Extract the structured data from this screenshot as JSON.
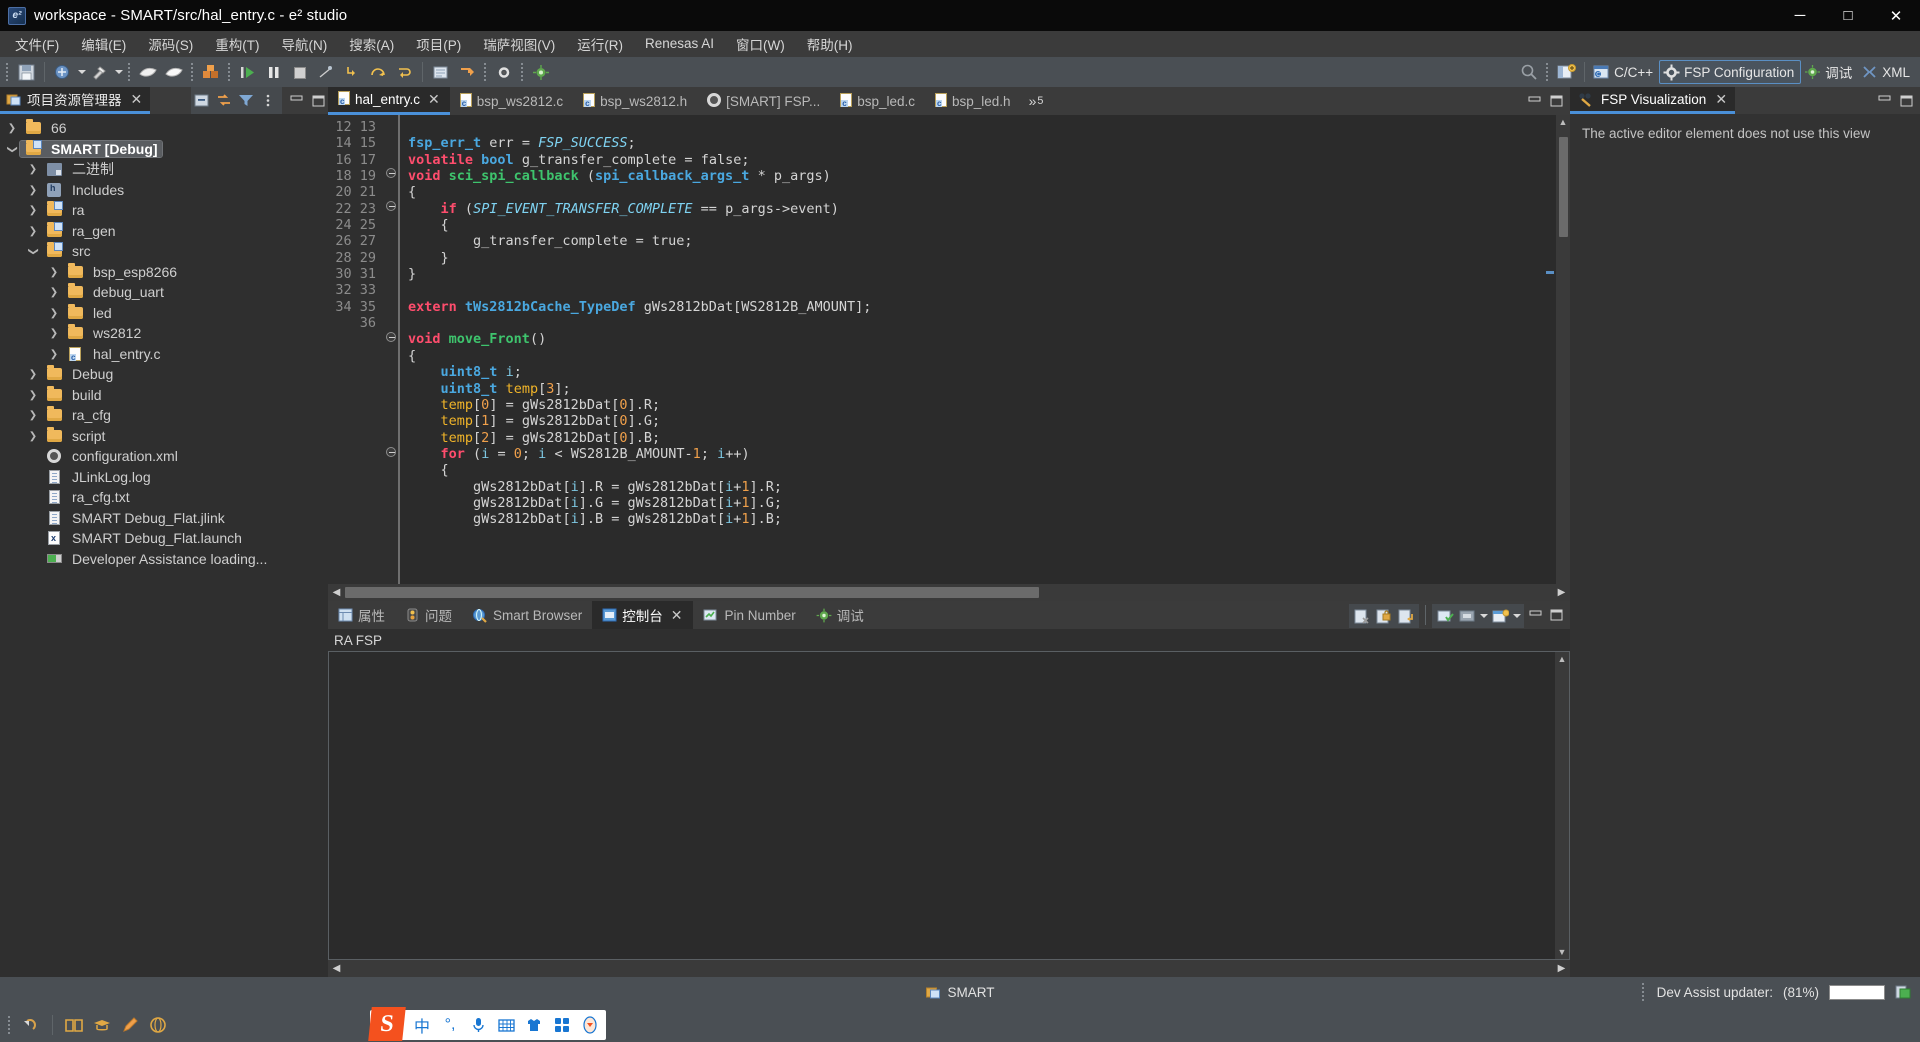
{
  "window": {
    "title": "workspace - SMART/src/hal_entry.c - e² studio",
    "app_icon": "e2studio-icon",
    "minimize": "─",
    "maximize": "□",
    "close": "✕"
  },
  "menubar": {
    "items": [
      {
        "label": "文件(F)",
        "name": "menu-file"
      },
      {
        "label": "编辑(E)",
        "name": "menu-edit"
      },
      {
        "label": "源码(S)",
        "name": "menu-source"
      },
      {
        "label": "重构(T)",
        "name": "menu-refactor"
      },
      {
        "label": "导航(N)",
        "name": "menu-navigate"
      },
      {
        "label": "搜索(A)",
        "name": "menu-search"
      },
      {
        "label": "项目(P)",
        "name": "menu-project"
      },
      {
        "label": "瑞萨视图(V)",
        "name": "menu-renesas-views"
      },
      {
        "label": "运行(R)",
        "name": "menu-run"
      },
      {
        "label": "Renesas AI",
        "name": "menu-renesas-ai"
      },
      {
        "label": "窗口(W)",
        "name": "menu-window"
      },
      {
        "label": "帮助(H)",
        "name": "menu-help"
      }
    ]
  },
  "toolbar": {
    "perspectives": [
      {
        "label": "C/C++",
        "name": "perspective-cpp",
        "active": false
      },
      {
        "label": "FSP Configuration",
        "name": "perspective-fsp-configuration",
        "active": true
      },
      {
        "label": "调试",
        "name": "perspective-debug",
        "active": false
      },
      {
        "label": "XML",
        "name": "perspective-xml",
        "active": false
      }
    ]
  },
  "project_explorer": {
    "tab_label": "项目资源管理器",
    "tab_icon": "project-explorer-icon",
    "close_label": "✕",
    "tree": [
      {
        "label": "66",
        "icon": "folder",
        "depth": 0,
        "twist": "closed",
        "selected": false
      },
      {
        "label": "SMART [Debug]",
        "icon": "project-folder",
        "depth": 0,
        "twist": "open",
        "selected": true
      },
      {
        "label": "二进制",
        "icon": "binary",
        "depth": 1,
        "twist": "closed",
        "selected": false
      },
      {
        "label": "Includes",
        "icon": "includes",
        "depth": 1,
        "twist": "closed",
        "selected": false
      },
      {
        "label": "ra",
        "icon": "project-folder",
        "depth": 1,
        "twist": "closed",
        "selected": false
      },
      {
        "label": "ra_gen",
        "icon": "project-folder",
        "depth": 1,
        "twist": "closed",
        "selected": false
      },
      {
        "label": "src",
        "icon": "project-folder",
        "depth": 1,
        "twist": "open",
        "selected": false
      },
      {
        "label": "bsp_esp8266",
        "icon": "folder",
        "depth": 2,
        "twist": "closed",
        "selected": false
      },
      {
        "label": "debug_uart",
        "icon": "folder",
        "depth": 2,
        "twist": "closed",
        "selected": false
      },
      {
        "label": "led",
        "icon": "folder",
        "depth": 2,
        "twist": "closed",
        "selected": false
      },
      {
        "label": "ws2812",
        "icon": "folder",
        "depth": 2,
        "twist": "closed",
        "selected": false
      },
      {
        "label": "hal_entry.c",
        "icon": "c-file",
        "depth": 2,
        "twist": "closed",
        "selected": false
      },
      {
        "label": "Debug",
        "icon": "folder",
        "depth": 1,
        "twist": "closed",
        "selected": false
      },
      {
        "label": "build",
        "icon": "folder",
        "depth": 1,
        "twist": "closed",
        "selected": false
      },
      {
        "label": "ra_cfg",
        "icon": "folder",
        "depth": 1,
        "twist": "closed",
        "selected": false
      },
      {
        "label": "script",
        "icon": "folder",
        "depth": 1,
        "twist": "closed",
        "selected": false
      },
      {
        "label": "configuration.xml",
        "icon": "gear",
        "depth": 1,
        "twist": "none",
        "selected": false
      },
      {
        "label": "JLinkLog.log",
        "icon": "text-file",
        "depth": 1,
        "twist": "none",
        "selected": false
      },
      {
        "label": "ra_cfg.txt",
        "icon": "text-file",
        "depth": 1,
        "twist": "none",
        "selected": false
      },
      {
        "label": "SMART Debug_Flat.jlink",
        "icon": "text-file",
        "depth": 1,
        "twist": "none",
        "selected": false
      },
      {
        "label": "SMART Debug_Flat.launch",
        "icon": "xml-file",
        "depth": 1,
        "twist": "none",
        "selected": false
      },
      {
        "label": "Developer Assistance loading...",
        "icon": "dev-assist",
        "depth": 1,
        "twist": "none",
        "selected": false
      }
    ]
  },
  "editor": {
    "tabs": [
      {
        "label": "hal_entry.c",
        "icon": "c-file",
        "active": true,
        "closable": true
      },
      {
        "label": "bsp_ws2812.c",
        "icon": "c-file",
        "active": false,
        "closable": false
      },
      {
        "label": "bsp_ws2812.h",
        "icon": "c-file",
        "active": false,
        "closable": false
      },
      {
        "label": "[SMART] FSP...",
        "icon": "gear",
        "active": false,
        "closable": false
      },
      {
        "label": "bsp_led.c",
        "icon": "c-file",
        "active": false,
        "closable": false
      },
      {
        "label": "bsp_led.h",
        "icon": "c-file",
        "active": false,
        "closable": false
      }
    ],
    "more_tabs_symbol": "»",
    "more_tabs_count": "5",
    "first_line_number": 12,
    "line_numbers": [
      12,
      13,
      14,
      15,
      16,
      17,
      18,
      19,
      20,
      21,
      22,
      23,
      24,
      25,
      26,
      27,
      28,
      29,
      30,
      31,
      32,
      33,
      34,
      35,
      36
    ],
    "code_lines": [
      "",
      "fsp_err_t err = FSP_SUCCESS;",
      "volatile bool g_transfer_complete = false;",
      "void sci_spi_callback (spi_callback_args_t * p_args)",
      "{",
      "    if (SPI_EVENT_TRANSFER_COMPLETE == p_args->event)",
      "    {",
      "        g_transfer_complete = true;",
      "    }",
      "}",
      "",
      "extern tWs2812bCache_TypeDef gWs2812bDat[WS2812B_AMOUNT];",
      "",
      "void move_Front()",
      "{",
      "    uint8_t i;",
      "    uint8_t temp[3];",
      "    temp[0] = gWs2812bDat[0].R;",
      "    temp[1] = gWs2812bDat[0].G;",
      "    temp[2] = gWs2812bDat[0].B;",
      "    for (i = 0; i < WS2812B_AMOUNT-1; i++)",
      "    {",
      "        gWs2812bDat[i].R = gWs2812bDat[i+1].R;",
      "        gWs2812bDat[i].G = gWs2812bDat[i+1].G;",
      "        gWs2812bDat[i].B = gWs2812bDat[i+1].B;"
    ],
    "colors": {
      "keyword": "#ff4d6d",
      "type": "#4aa8e0",
      "function": "#3ec46d",
      "macro": "#7fd3f2",
      "number": "#f0a04b",
      "variable": "#f0b429",
      "plain": "#d4d4d4",
      "background": "#2b2b2b",
      "gutter_text": "#8c8c8c"
    }
  },
  "bottom_panel": {
    "tabs": [
      {
        "label": "属性",
        "icon": "properties-icon",
        "active": false,
        "closable": false
      },
      {
        "label": "问题",
        "icon": "problems-icon",
        "active": false,
        "closable": false
      },
      {
        "label": "Smart Browser",
        "icon": "smart-browser-icon",
        "active": false,
        "closable": false
      },
      {
        "label": "控制台",
        "icon": "console-icon",
        "active": true,
        "closable": true
      },
      {
        "label": "Pin Number",
        "icon": "pin-number-icon",
        "active": false,
        "closable": false
      },
      {
        "label": "调试",
        "icon": "debug-icon",
        "active": false,
        "closable": false
      }
    ],
    "console_title": "RA FSP",
    "console_output": ""
  },
  "fsp_visualization": {
    "tab_label": "FSP Visualization",
    "tab_icon": "fsp-visualization-icon",
    "close_label": "✕",
    "message": "The active editor element does not use this view"
  },
  "statusbar": {
    "project_label": "SMART",
    "project_icon": "project-folder-icon",
    "updater_label": "Dev Assist updater:",
    "updater_progress": "(81%)"
  },
  "taskbar": {
    "left_icons": [
      "undo-icon",
      "book-icon",
      "graduation-icon",
      "pencil-icon",
      "globe-icon"
    ],
    "tray": {
      "logo": "S",
      "items": [
        "中",
        "°,",
        "microphone-icon",
        "keyboard-icon",
        "shirt-icon",
        "apps-icon",
        "fox-icon"
      ]
    }
  }
}
